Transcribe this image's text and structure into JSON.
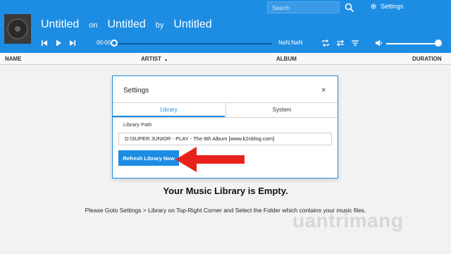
{
  "player": {
    "title": "Untitled",
    "on_label": "on",
    "album": "Untitled",
    "by_label": "by",
    "artist": "Untitled",
    "time_current": "00:00",
    "time_total": "NaN:NaN",
    "search_placeholder": "Search",
    "settings_label": "Settings",
    "accent_color": "#1d8de3",
    "icons": [
      "previous-icon",
      "play-icon",
      "next-icon",
      "repeat-icon",
      "shuffle-icon",
      "queue-icon",
      "volume-icon",
      "search-icon",
      "gear-icon"
    ]
  },
  "columns": {
    "name": "NAME",
    "artist": "ARTIST",
    "album": "ALBUM",
    "duration": "DURATION"
  },
  "empty": {
    "title": "Your Music Library is Empty.",
    "subtitle": "Please Goto Settings > Library on Top-Right Corner and Select the Folder which contains your music files."
  },
  "dialog": {
    "title": "Settings",
    "close_glyph": "×",
    "tabs": [
      "Library",
      "System"
    ],
    "path_label": "Library Path",
    "path_value": "D:\\SUPER JUNIOR - PLAY - The 8th Album [www.k2nblog.com]",
    "refresh_label": "Refresh Library Now"
  },
  "watermark": "uantrimang"
}
